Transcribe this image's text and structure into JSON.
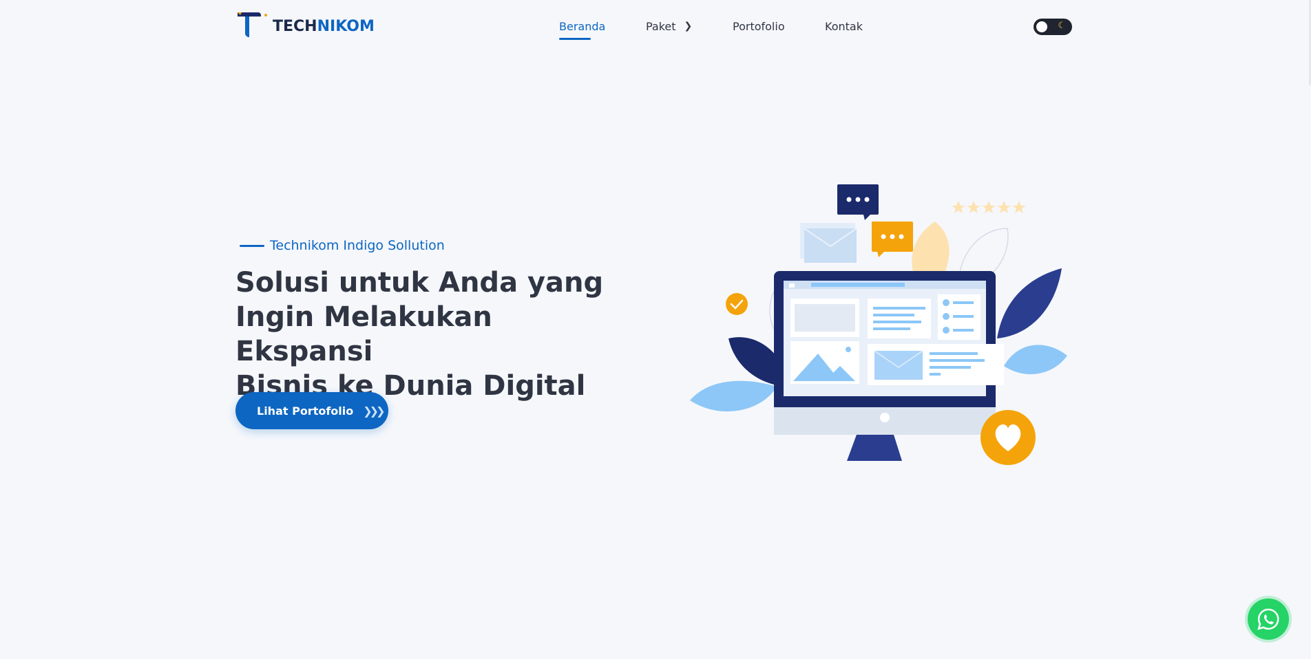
{
  "header": {
    "logo": {
      "part_a": "TECH",
      "part_b": "NIKOM"
    },
    "nav": [
      {
        "label": "Beranda",
        "active": true
      },
      {
        "label": "Paket",
        "has_submenu": true
      },
      {
        "label": "Portofolio"
      },
      {
        "label": "Kontak"
      }
    ],
    "theme_toggle": {
      "icon_on": "moon-icon",
      "icon_off": "sun-knob"
    }
  },
  "hero": {
    "eyebrow": "Technikom Indigo Sollution",
    "headline_lines": [
      "Solusi untuk Anda yang",
      "Ingin Melakukan Ekspansi",
      "Bisnis ke Dunia Digital"
    ],
    "cta_label": "Lihat Portofolio"
  },
  "floating": {
    "whatsapp_icon": "whatsapp-icon"
  },
  "colors": {
    "brand_blue": "#0d66c2",
    "dark_text": "#2f3542",
    "navy": "#1b2a6b",
    "accent_orange": "#f5a30a",
    "light_blue": "#8cc7f7",
    "whatsapp_green": "#25d366",
    "page_bg": "#f5f7fb"
  }
}
